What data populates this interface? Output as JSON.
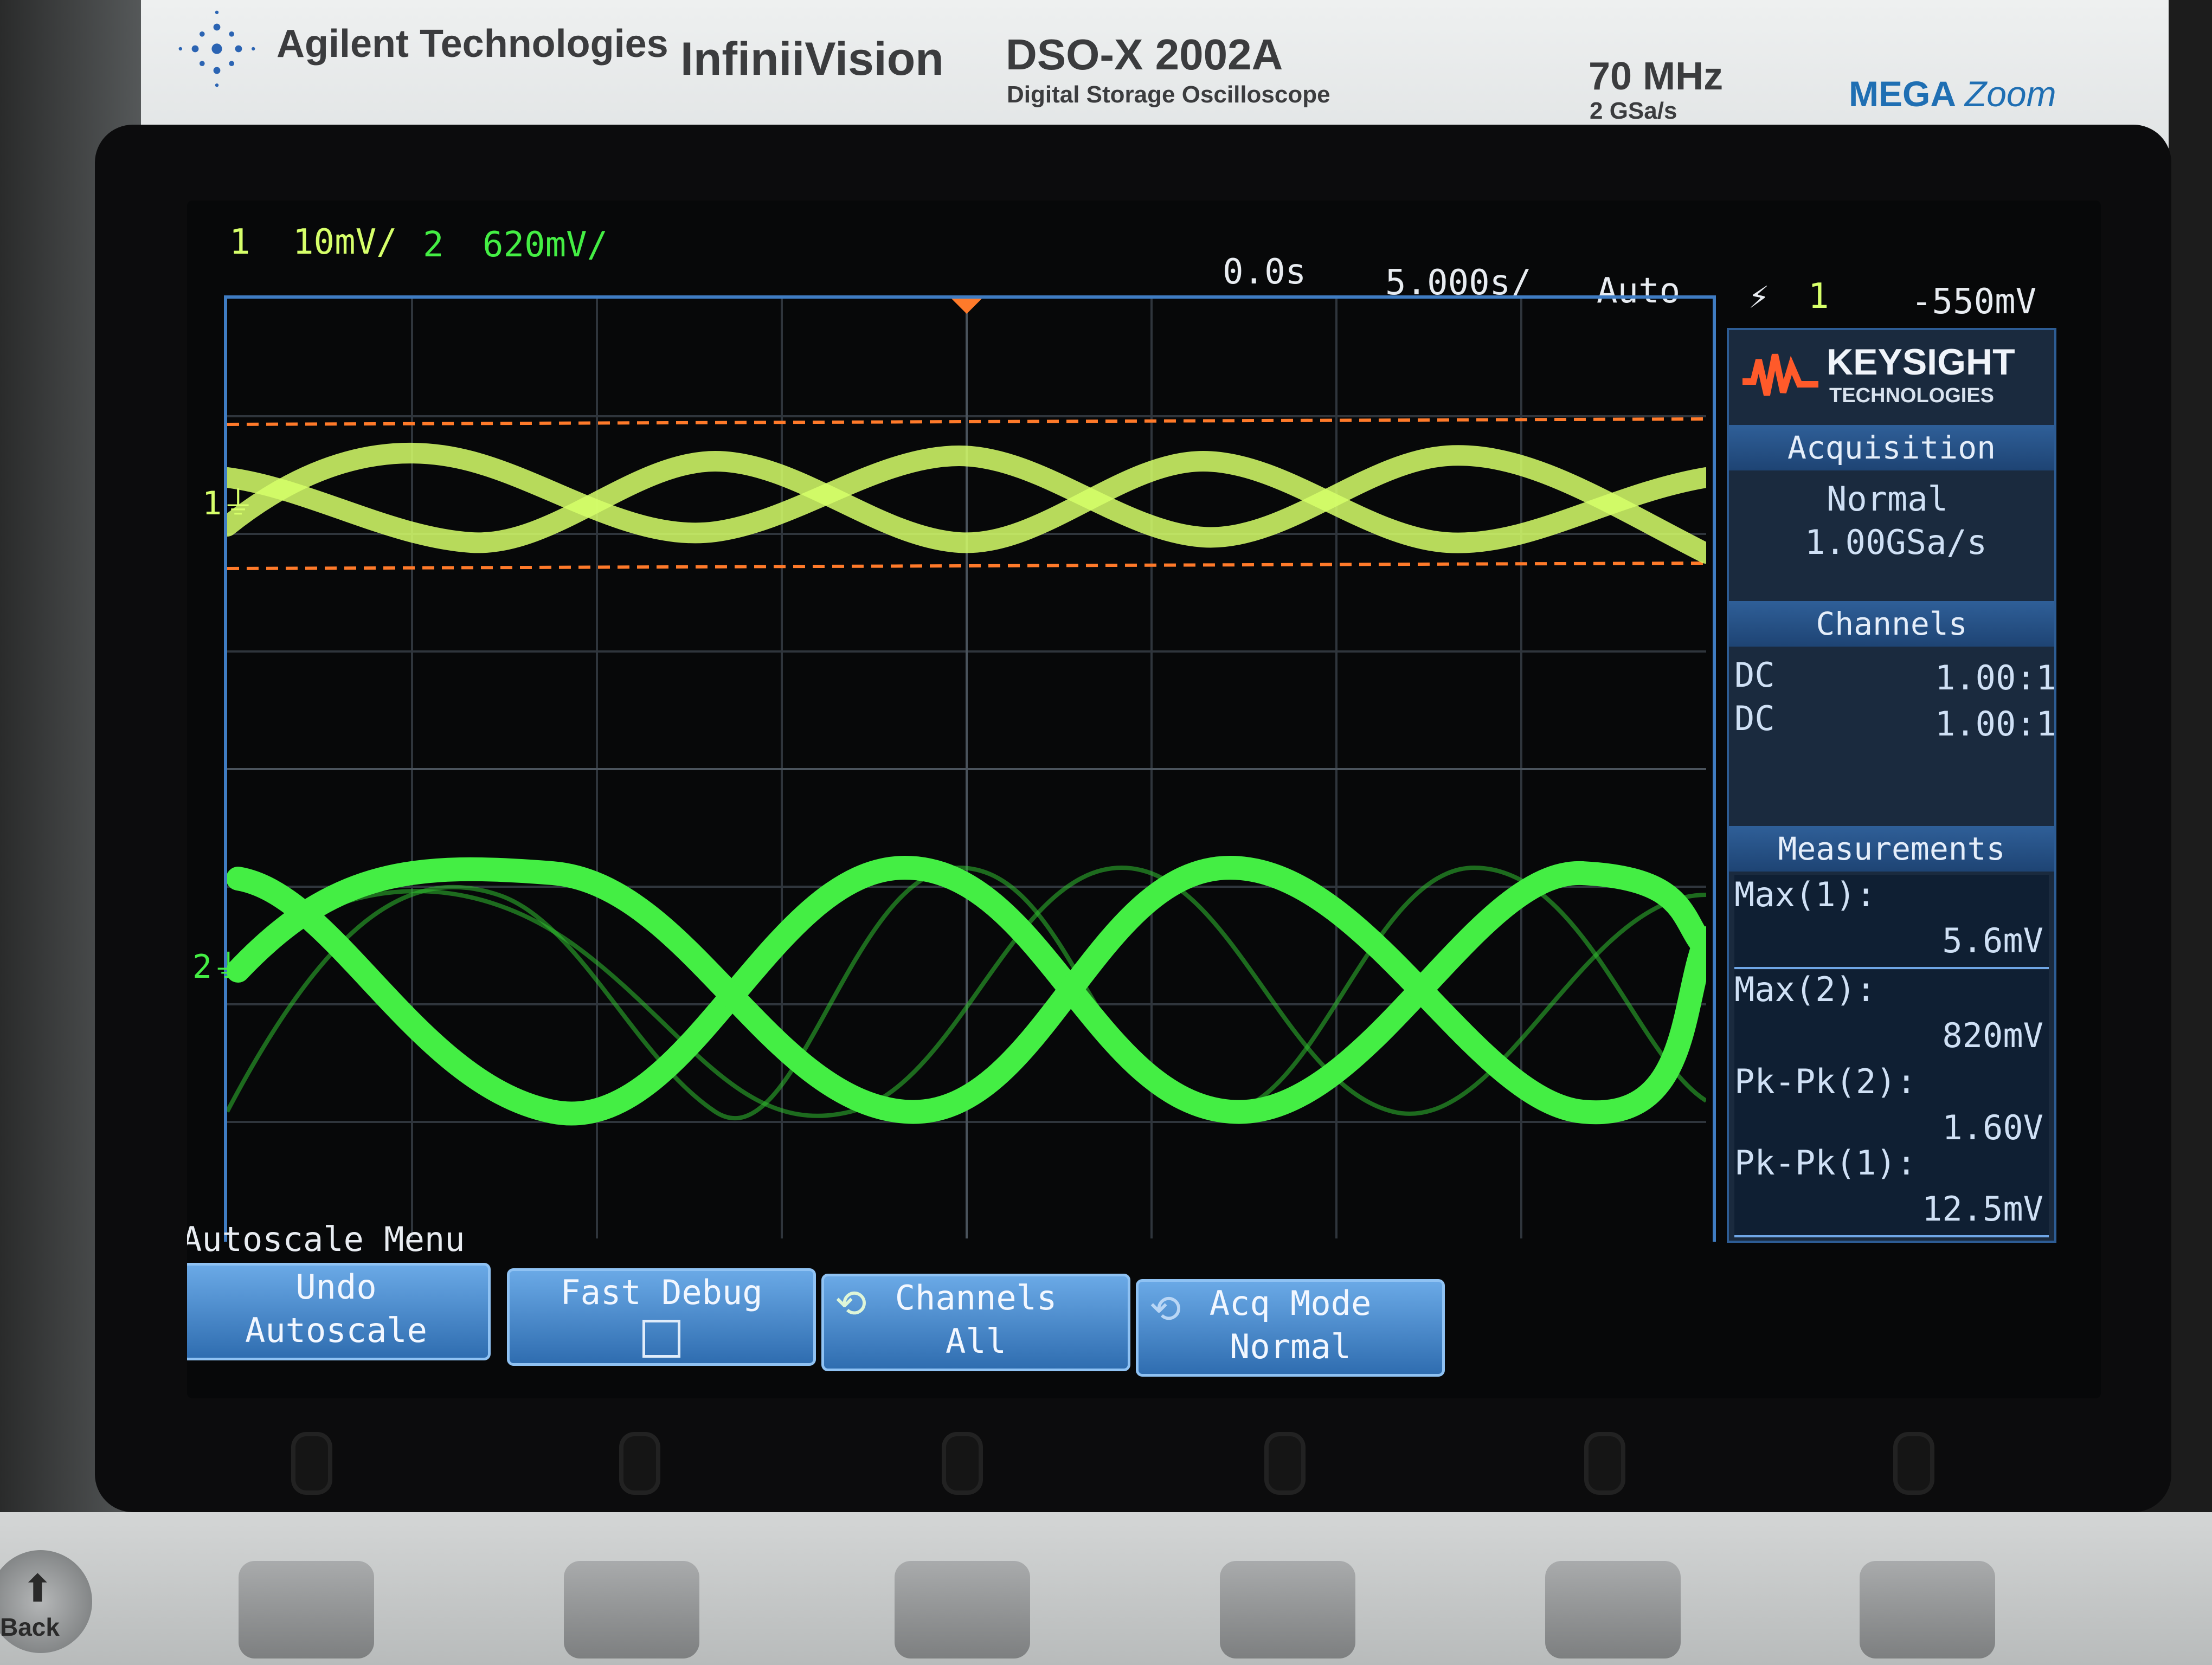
{
  "device": {
    "maker": "Agilent Technologies",
    "series": "InfiniiVision",
    "model": "DSO-X 2002A",
    "model_subtitle": "Digital Storage Oscilloscope",
    "bandwidth": "70 MHz",
    "sample_rate": "2 GSa/s",
    "logo_mega": "MEGA",
    "logo_zoom": "Zoom"
  },
  "status_bar": {
    "ch1_num": "1",
    "ch1_scale": "10mV/",
    "ch2_num": "2",
    "ch2_scale": "620mV/",
    "delay": "0.0s",
    "timebase": "5.000s/",
    "trigger_mode": "Auto",
    "trigger_source": "1",
    "trigger_level": "-550mV"
  },
  "markers": {
    "ch1": "1",
    "ch2": "2"
  },
  "side_panel": {
    "brand": "KEYSIGHT",
    "brand_sub": "TECHNOLOGIES",
    "acquisition_title": "Acquisition",
    "acquisition_mode": "Normal",
    "acquisition_rate": "1.00GSa/s",
    "channels_title": "Channels",
    "channels": [
      {
        "coupling": "DC",
        "probe": "1.00:1"
      },
      {
        "coupling": "DC",
        "probe": "1.00:1"
      }
    ],
    "measurements_title": "Measurements",
    "measurements": [
      {
        "label": "Max(1):",
        "value": "5.6mV"
      },
      {
        "label": "Max(2):",
        "value": "820mV"
      },
      {
        "label": "Pk-Pk(2):",
        "value": "1.60V"
      },
      {
        "label": "Pk-Pk(1):",
        "value": "12.5mV"
      }
    ]
  },
  "menu": {
    "title": "Autoscale Menu",
    "softkeys": [
      {
        "line1": "Undo",
        "line2": "Autoscale"
      },
      {
        "line1": "Fast Debug",
        "line2": ""
      },
      {
        "line1": "Channels",
        "line2": "All"
      },
      {
        "line1": "Acq Mode",
        "line2": "Normal"
      }
    ]
  },
  "hardware": {
    "back_label": "Back"
  },
  "colors": {
    "ch1": "#d6ff6a",
    "ch2": "#44ee44",
    "cursor": "#ff7a2a",
    "grid": "#3a3f45",
    "frame": "#3f7cc2"
  }
}
